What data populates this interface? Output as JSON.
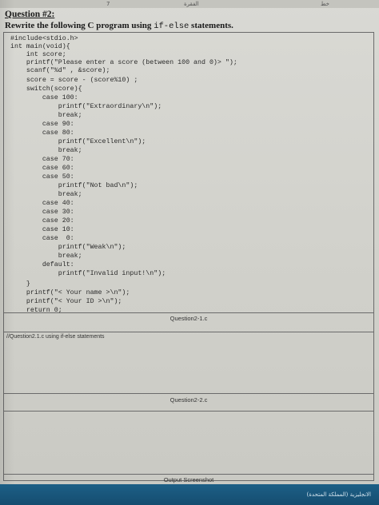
{
  "top_bar": {
    "mark_left": "7",
    "mark_center": "الفقرة",
    "mark_right": "خط"
  },
  "question": {
    "label": "Question #2:",
    "instruction_prefix": "Rewrite the following C program using ",
    "instruction_code": "if-else",
    "instruction_suffix": " statements."
  },
  "code": [
    "#include<stdio.h>",
    "int main(void){",
    "    int score;",
    "    printf(\"Please enter a score (between 100 and 0)> \");",
    "    scanf(\"%d\" , &score);",
    "    score = score - (score%10) ;",
    "    switch(score){",
    "        case 100:",
    "            printf(\"Extraordinary\\n\");",
    "            break;",
    "        case 90:",
    "        case 80:",
    "            printf(\"Excellent\\n\");",
    "            break;",
    "        case 70:",
    "        case 60:",
    "        case 50:",
    "            printf(\"Not bad\\n\");",
    "            break;",
    "        case 40:",
    "        case 30:",
    "        case 20:",
    "        case 10:",
    "        case  0:",
    "            printf(\"Weak\\n\");",
    "            break;",
    "        default:",
    "            printf(\"Invalid input!\\n\");",
    "    }",
    "    printf(\"< Your name >\\n\");",
    "    printf(\"< Your ID >\\n\");",
    "    return 0;",
    "}"
  ],
  "captions": {
    "question2_1": "Question2-1.c",
    "question2_2": "Question2-2.c",
    "output": "Output Screenshot"
  },
  "answer_label": "//Question2.1.c using if-else statements",
  "footer": {
    "text": "الانجليزية (المملكة المتحدة)"
  }
}
